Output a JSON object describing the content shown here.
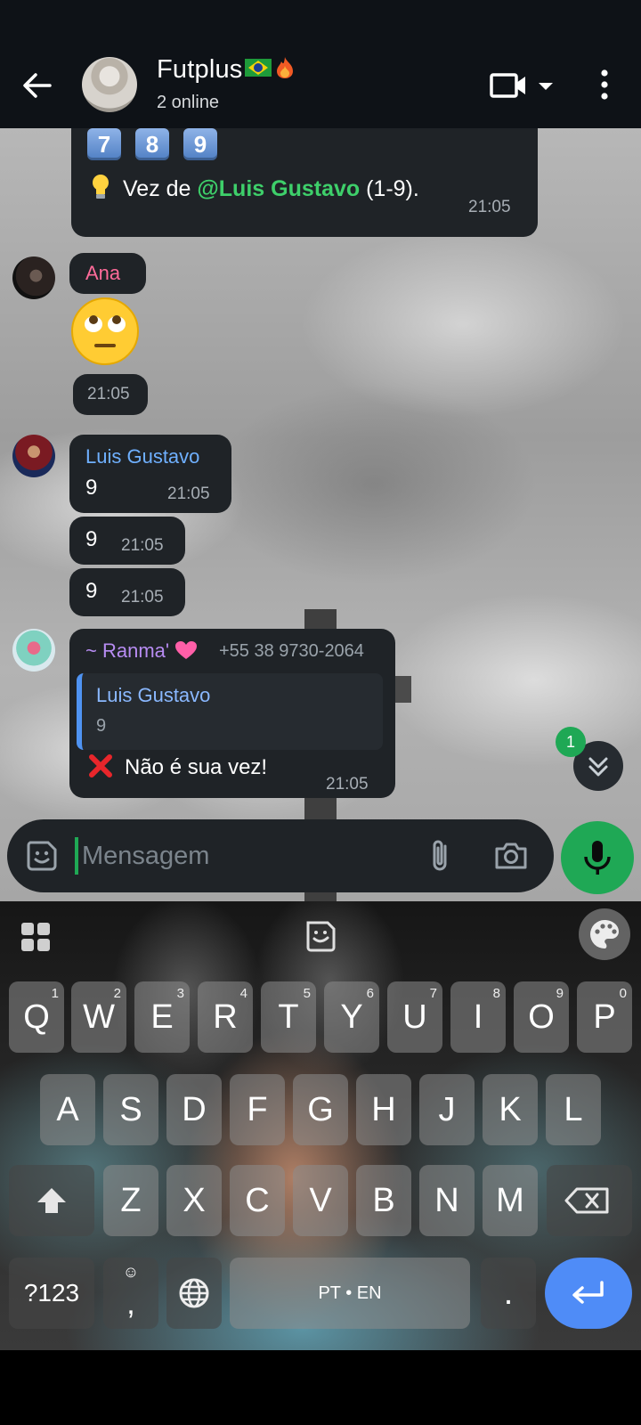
{
  "header": {
    "title": "Futplus",
    "subtitle": "2 online"
  },
  "messages": {
    "top": {
      "number_keys": [
        "7",
        "8",
        "9"
      ],
      "turn_prefix": "Vez de ",
      "turn_mention": "@Luis Gustavo",
      "turn_suffix": " (1-9).",
      "time": "21:05"
    },
    "ana": {
      "sender": "Ana",
      "emoji": "eye-roll-emoji",
      "time": "21:05"
    },
    "luis": {
      "sender": "Luis Gustavo",
      "items": [
        {
          "text": "9",
          "time": "21:05"
        },
        {
          "text": "9",
          "time": "21:05"
        },
        {
          "text": "9",
          "time": "21:05"
        }
      ]
    },
    "ranma": {
      "sender": "~ Ranma'",
      "phone": "+55 38 9730-2064",
      "reply_name": "Luis Gustavo",
      "reply_text": "9",
      "text": "Não é sua vez!",
      "time": "21:05"
    }
  },
  "scroll": {
    "unread_count": "1"
  },
  "composer": {
    "placeholder": "Mensagem"
  },
  "keyboard": {
    "row1": [
      {
        "letter": "Q",
        "hint": "1"
      },
      {
        "letter": "W",
        "hint": "2"
      },
      {
        "letter": "E",
        "hint": "3"
      },
      {
        "letter": "R",
        "hint": "4"
      },
      {
        "letter": "T",
        "hint": "5"
      },
      {
        "letter": "Y",
        "hint": "6"
      },
      {
        "letter": "U",
        "hint": "7"
      },
      {
        "letter": "I",
        "hint": "8"
      },
      {
        "letter": "O",
        "hint": "9"
      },
      {
        "letter": "P",
        "hint": "0"
      }
    ],
    "row2": [
      "A",
      "S",
      "D",
      "F",
      "G",
      "H",
      "J",
      "K",
      "L"
    ],
    "row3": [
      "Z",
      "X",
      "C",
      "V",
      "B",
      "N",
      "M"
    ],
    "symbols_label": "?123",
    "comma": ",",
    "period": ".",
    "space_label": "PT • EN"
  },
  "colors": {
    "accent": "#1fa855",
    "mention": "#3ecf6a",
    "ana_name": "#ff6b9a",
    "luis_name": "#6fb0ff",
    "ranma_name": "#b78cf2",
    "enter_key": "#4f8cf7",
    "bubble": "#1f2327"
  }
}
